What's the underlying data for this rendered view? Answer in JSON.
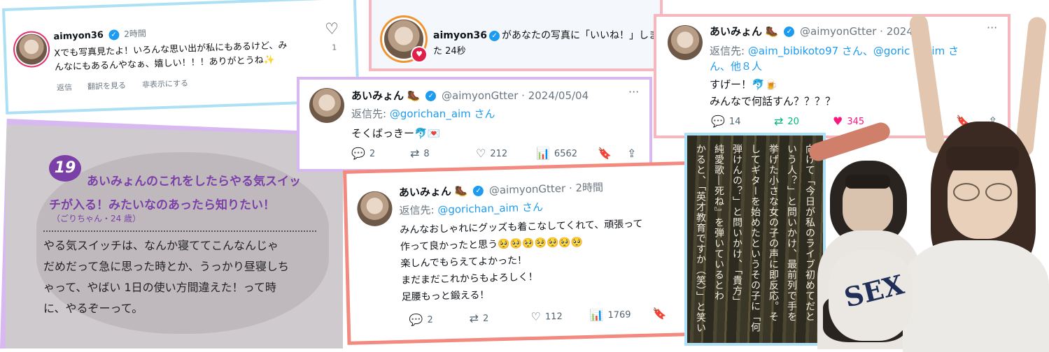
{
  "insta": {
    "username": "aimyon36",
    "time": "2時間",
    "line1": "Xでも写真見たよ！いろんな思い出が私にもあるけど、み",
    "line2": "んなにもあるんやなぁ、嬉しい！！！ありがとうね✨",
    "like_count": "1",
    "actions": [
      "返信",
      "翻訳を見る",
      "非表示にする"
    ]
  },
  "notif": {
    "username": "aimyon36",
    "line1": "があなたの写真に「いいね！」しまし",
    "line2": "た 24秒"
  },
  "tweet_a": {
    "name": "あいみょん",
    "emoji": "🥾",
    "handle": "@aimyonGtter",
    "date": "· 2024",
    "reply_label": "返信先: ",
    "reply_to_line1": "@aim_bibikoto97 さん、@goric",
    "reply_to_tail": "aim さ",
    "reply_to_line2": "ん、他８人",
    "body1": "すげー！🐬🍺",
    "body2": "みんなで何話すん？？？？",
    "replies": "14",
    "retweets": "20",
    "likes": "345"
  },
  "tweet_b": {
    "name": "あいみょん",
    "emoji": "🥾",
    "handle": "@aimyonGtter",
    "date": "· 2024/05/04",
    "reply_label": "返信先: ",
    "reply_to": "@gorichan_aim さん",
    "body": "そくばっきー🐬💌",
    "replies": "2",
    "retweets": "8",
    "likes": "212",
    "views": "6562"
  },
  "tweet_c": {
    "name": "あいみょん",
    "emoji": "🥾",
    "handle": "@aimyonGtter",
    "date": "· 2時間",
    "reply_label": "返信先: ",
    "reply_to": "@gorichan_aim さん",
    "body": [
      "みんなおしゃれにグッズも着こなしてくれて、頑張って",
      "作って良かったと思う🥺🥺🥺🥺🥺🥺🥺",
      "楽しんでもらえてよかった！",
      "まだまだこれからもよろしく！",
      "足腰もっと鍛える！"
    ],
    "replies": "2",
    "retweets": "2",
    "likes": "112",
    "views": "1769"
  },
  "magazine": {
    "number": "19",
    "question1": "あいみょんのこれをしたらやる気スイッ",
    "question2": "チが入る！みたいなのあったら知りたい！",
    "asker": "（ごりちゃん・24 歳）",
    "answer": [
      "やる気スイッチは、なんか寝ててこんなんじゃ",
      "だめだって急に思った時とか、うっかり昼寝しち",
      "ゃって、やばい 1日の使い方間違えた！って時",
      "に、やるぞーって。"
    ]
  },
  "book": {
    "columns": [
      "向けて「今日が私のライブ初めてだと",
      "いう人？」と問いかけ、最前列で手を",
      "挙げた小さな女の子の声に即反応。そ",
      "してギターを始めたというその子に「何",
      "弾けんの？」と問いかけ、「貴方」",
      "純愛歌―死ね』を弾いているとわ",
      "かると、「英才教育ですか（笑）」と笑い"
    ]
  },
  "photo": {
    "shirt_text": "SEX"
  },
  "colors": {
    "blue": "#1d9bf0",
    "pink": "#f91880",
    "green": "#00ba7c",
    "card_blue_border": "#aee0f5",
    "card_pink_border": "#f6b7bf",
    "card_purple_border": "#d8b8f0",
    "card_red_border": "#f28a7f",
    "magazine_bg": "#cfcacd",
    "magazine_purple": "#8b4fb8"
  }
}
